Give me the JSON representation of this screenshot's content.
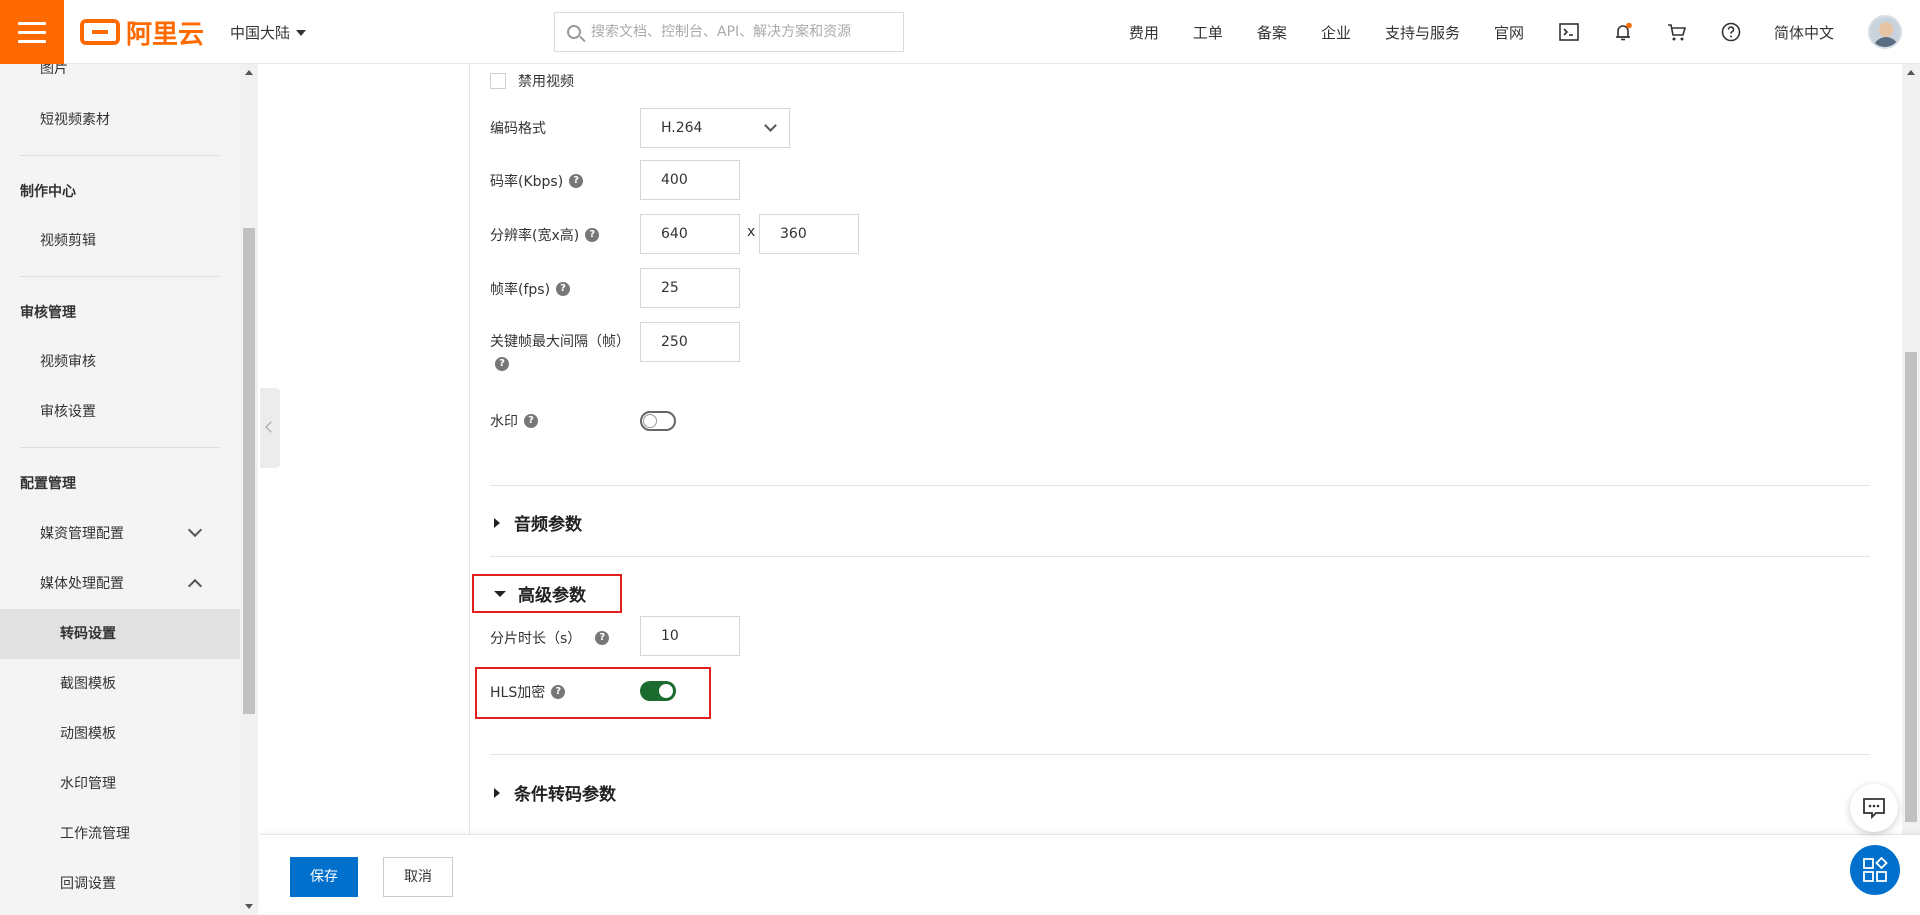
{
  "header": {
    "logo_text": "阿里云",
    "region": "中国大陆",
    "search_placeholder": "搜索文档、控制台、API、解决方案和资源",
    "nav": [
      "费用",
      "工单",
      "备案",
      "企业",
      "支持与服务",
      "官网"
    ],
    "language": "简体中文",
    "brand_color": "#ff6a00"
  },
  "sidebar": {
    "items": [
      {
        "label": "图片",
        "level": "lvl1"
      },
      {
        "label": "短视频素材",
        "level": "lvl1"
      },
      {
        "label": "制作中心",
        "level": "group"
      },
      {
        "label": "视频剪辑",
        "level": "lvl1"
      },
      {
        "label": "审核管理",
        "level": "group"
      },
      {
        "label": "视频审核",
        "level": "lvl1"
      },
      {
        "label": "审核设置",
        "level": "lvl1"
      },
      {
        "label": "配置管理",
        "level": "group"
      },
      {
        "label": "媒资管理配置",
        "level": "lvl1",
        "expanded": false
      },
      {
        "label": "媒体处理配置",
        "level": "lvl1",
        "expanded": true
      },
      {
        "label": "转码设置",
        "level": "lvl2",
        "active": true
      },
      {
        "label": "截图模板",
        "level": "lvl2"
      },
      {
        "label": "动图模板",
        "level": "lvl2"
      },
      {
        "label": "水印管理",
        "level": "lvl2"
      },
      {
        "label": "工作流管理",
        "level": "lvl2"
      },
      {
        "label": "回调设置",
        "level": "lvl2"
      }
    ]
  },
  "form": {
    "disable_video_label": "禁用视频",
    "codec_label": "编码格式",
    "codec_value": "H.264",
    "bitrate_label": "码率(Kbps)",
    "bitrate_value": "400",
    "resolution_label": "分辨率(宽x高)",
    "width_value": "640",
    "resolution_sep": "x",
    "height_value": "360",
    "fps_label": "帧率(fps)",
    "fps_value": "25",
    "gop_label": "关键帧最大间隔（帧）",
    "gop_value": "250",
    "watermark_label": "水印",
    "watermark_on": false,
    "audio_section": "音频参数",
    "advanced_section": "高级参数",
    "segment_label": "分片时长（s）",
    "segment_value": "10",
    "hls_label": "HLS加密",
    "hls_on": true,
    "conditional_section": "条件转码参数",
    "help_glyph": "?"
  },
  "footer": {
    "save": "保存",
    "cancel": "取消",
    "primary_color": "#0070cc"
  },
  "highlight_color": "#e02020"
}
